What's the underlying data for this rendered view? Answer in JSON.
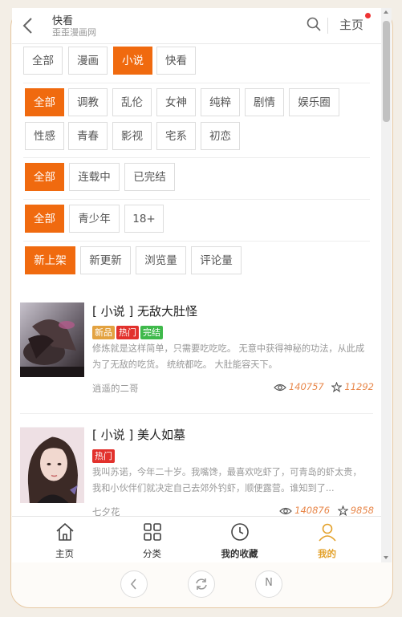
{
  "header": {
    "title": "快看",
    "subtitle": "歪歪漫画网",
    "home_label": "主页"
  },
  "filters": {
    "category": [
      "全部",
      "漫画",
      "小说",
      "快看"
    ],
    "genre_row1": [
      "全部",
      "调教",
      "乱伦",
      "女神",
      "纯粹",
      "剧情",
      "娱乐圈"
    ],
    "genre_row2": [
      "性感",
      "青春",
      "影视",
      "宅系",
      "初恋"
    ],
    "status": [
      "全部",
      "连载中",
      "已完结"
    ],
    "age": [
      "全部",
      "青少年",
      "18+"
    ],
    "sort": [
      "新上架",
      "新更新",
      "浏览量",
      "评论量"
    ]
  },
  "items": [
    {
      "title": "[ 小说 ] 无敌大肚怪",
      "tags": [
        "新品",
        "热门",
        "完结"
      ],
      "desc": "修炼就是这样简单，只需要吃吃吃。 无意中获得神秘的功法，从此成为了无敌的吃货。 统统都吃。 大肚能容天下。",
      "author": "逍遥的二哥",
      "views": "140757",
      "favorites": "11292"
    },
    {
      "title": "[ 小说 ] 美人如墓",
      "tags": [
        "热门"
      ],
      "desc": "我叫苏诺，今年二十岁。我嘴馋，最喜欢吃虾了，可青岛的虾太贵，我和小伙伴们就决定自己去郊外钓虾，顺便露营。谁知到了...",
      "author": "七夕花",
      "views": "140876",
      "favorites": "9858"
    }
  ],
  "tabbar": [
    "主页",
    "分类",
    "我的收藏",
    "我的"
  ],
  "bottom_nav": {
    "n_label": "N"
  },
  "colors": {
    "accent": "#f06a0f",
    "tab_active": "#e3a12a",
    "tag_new": "#e3a240",
    "tag_hot": "#e2312c",
    "tag_done": "#3fb94b"
  }
}
